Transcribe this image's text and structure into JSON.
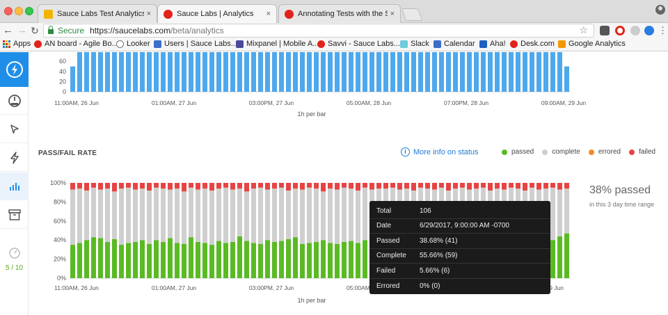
{
  "browser": {
    "tabs": [
      {
        "title": "Sauce Labs Test Analytics GA",
        "favicon_color": "#f2b400"
      },
      {
        "title": "Sauce Labs | Analytics",
        "favicon_color": "#e2231a"
      },
      {
        "title": "Annotating Tests with the Sau",
        "favicon_color": "#e2231a"
      }
    ],
    "close_glyph": "×",
    "secure_label": "Secure",
    "url_host": "https://saucelabs.com",
    "url_path": "/beta/analytics",
    "bookmarks": [
      {
        "label": "Apps",
        "icon": "apps-grid-icon"
      },
      {
        "label": "AN board - Agile Bo...",
        "icon": "sauce-favicon-icon",
        "color": "#e2231a"
      },
      {
        "label": "Looker",
        "icon": "looker-icon",
        "color": "#777777"
      },
      {
        "label": "Users | Sauce Labs...",
        "icon": "page-icon",
        "color": "#3b6ec9"
      },
      {
        "label": "Mixpanel | Mobile A...",
        "icon": "mixpanel-icon",
        "color": "#4a4a9c"
      },
      {
        "label": "Savvi - Sauce Labs...",
        "icon": "sauce-favicon-icon",
        "color": "#e2231a"
      },
      {
        "label": "Slack",
        "icon": "slack-icon",
        "color": "#6ecadc"
      },
      {
        "label": "Calendar",
        "icon": "calendar-icon",
        "color": "#3b6ec9"
      },
      {
        "label": "Aha!",
        "icon": "aha-icon",
        "color": "#1f5fbf"
      },
      {
        "label": "Desk.com",
        "icon": "sauce-favicon-icon",
        "color": "#e2231a"
      },
      {
        "label": "Google Analytics",
        "icon": "analytics-icon",
        "color": "#f29900"
      }
    ]
  },
  "sidebar": {
    "items": [
      {
        "icon": "gauge-icon"
      },
      {
        "icon": "cursor-icon"
      },
      {
        "icon": "bolt-icon"
      },
      {
        "icon": "bar-chart-icon"
      },
      {
        "icon": "archive-icon"
      }
    ],
    "usage": "5 / 10"
  },
  "colors": {
    "passed": "#5aba24",
    "complete": "#cfcfcf",
    "errored": "#f28b26",
    "failed": "#e84343",
    "volume_bar": "#4ea8ec"
  },
  "pass_fail": {
    "title": "PASS/FAIL RATE",
    "more_info": "More info on status",
    "legend": [
      {
        "label": "passed",
        "key": "passed"
      },
      {
        "label": "complete",
        "key": "complete"
      },
      {
        "label": "errored",
        "key": "errored"
      },
      {
        "label": "failed",
        "key": "failed"
      }
    ],
    "summary": "38% passed",
    "summary_sub": "in this 3 day time range"
  },
  "tooltip": {
    "rows": [
      {
        "label": "Total",
        "value": "106"
      },
      {
        "label": "Date",
        "value": "6/29/2017, 9:00:00 AM -0700"
      },
      {
        "label": "Passed",
        "value": "38.68% (41)"
      },
      {
        "label": "Complete",
        "value": "55.66% (59)"
      },
      {
        "label": "Failed",
        "value": "5.66% (6)"
      },
      {
        "label": "Errored",
        "value": "0% (0)"
      }
    ]
  },
  "chart_data": [
    {
      "type": "bar",
      "title": "",
      "xlabel": "1h per bar",
      "ylabel": "",
      "yticks": [
        "0",
        "20",
        "40",
        "60"
      ],
      "ylim": [
        0,
        90
      ],
      "xticks": [
        "11:00AM, 26 Jun",
        "01:00AM, 27 Jun",
        "03:00PM, 27 Jun",
        "05:00AM, 28 Jun",
        "07:00PM, 28 Jun",
        "09:00AM, 29 Jun"
      ],
      "bars": 72,
      "values_note": "all hourly volumes exceed the visible 60 scale; last bar about 50",
      "first_value": 50,
      "last_value": 50
    },
    {
      "type": "bar",
      "title": "PASS/FAIL RATE",
      "xlabel": "1h per bar",
      "yticks": [
        "0%",
        "20%",
        "40%",
        "60%",
        "80%",
        "100%"
      ],
      "ylim": [
        0,
        100
      ],
      "xticks": [
        "11:00AM, 26 Jun",
        "01:00AM, 27 Jun",
        "03:00PM, 27 Jun",
        "05:00AM, 28 Jun",
        "29 Jun"
      ],
      "series_names": [
        "passed",
        "complete",
        "failed"
      ],
      "passed": [
        35,
        37,
        40,
        43,
        42,
        38,
        41,
        35,
        37,
        38,
        40,
        36,
        40,
        38,
        42,
        37,
        36,
        43,
        38,
        37,
        35,
        39,
        37,
        38,
        44,
        39,
        37,
        36,
        40,
        38,
        39,
        41,
        43,
        36,
        37,
        38,
        40,
        37,
        36,
        38,
        39,
        37,
        40,
        38,
        37,
        39,
        40,
        38,
        41,
        36,
        37,
        42,
        38,
        39,
        38,
        40,
        37,
        41,
        38,
        39,
        36,
        40,
        38,
        37,
        41,
        39,
        37,
        35,
        38,
        40,
        44,
        47
      ],
      "failed": [
        7,
        6,
        8,
        5,
        7,
        6,
        9,
        6,
        5,
        7,
        6,
        8,
        5,
        6,
        7,
        6,
        9,
        5,
        7,
        6,
        8,
        6,
        5,
        7,
        6,
        9,
        6,
        5,
        7,
        6,
        5,
        8,
        6,
        7,
        5,
        6,
        9,
        6,
        7,
        5,
        6,
        8,
        5,
        7,
        6,
        6,
        5,
        7,
        6,
        8,
        5,
        6,
        7,
        5,
        8,
        6,
        5,
        7,
        6,
        5,
        8,
        6,
        7,
        5,
        6,
        8,
        5,
        7,
        6,
        5,
        7,
        6
      ]
    }
  ]
}
